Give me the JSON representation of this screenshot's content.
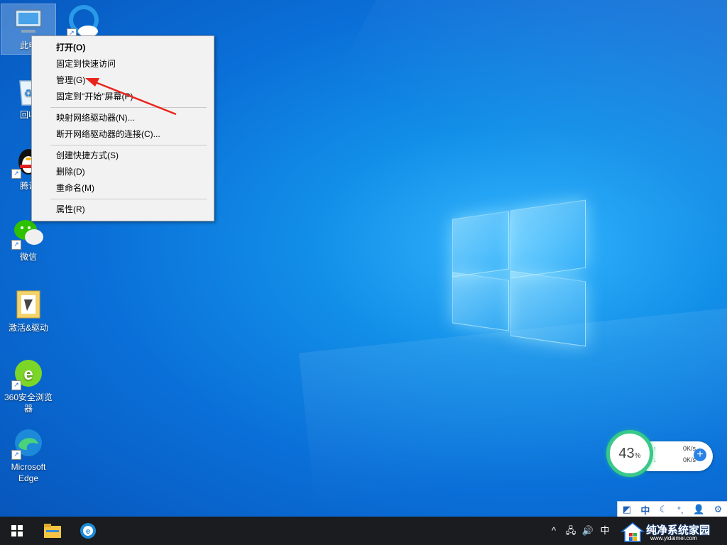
{
  "desktop": {
    "icons": [
      {
        "label": "此电",
        "icon": "computer-icon"
      },
      {
        "label": "",
        "icon": "cloud-drive-icon"
      },
      {
        "label": "回收",
        "icon": "recycle-bin-icon"
      },
      {
        "label": "腾讯",
        "icon": "qq-penguin-icon"
      },
      {
        "label": "微信",
        "icon": "wechat-icon"
      },
      {
        "label": "激活&驱动",
        "icon": "folder-icon"
      },
      {
        "label": "360安全浏览器",
        "icon": "browser-360-icon"
      },
      {
        "label": "Microsoft Edge",
        "icon": "edge-icon"
      }
    ]
  },
  "context_menu": {
    "items": [
      "打开(O)",
      "固定到快速访问",
      "管理(G)",
      "固定到\"开始\"屏幕(P)",
      "映射网络驱动器(N)...",
      "断开网络驱动器的连接(C)...",
      "创建快捷方式(S)",
      "删除(D)",
      "重命名(M)",
      "属性(R)"
    ]
  },
  "net_widget": {
    "percent": "43",
    "percent_unit": "%",
    "upload": "0K/s",
    "download": "0K/s"
  },
  "ime_toolbar": {
    "mode": "中"
  },
  "taskbar": {
    "ime_indicator": "中"
  },
  "watermark": {
    "title": "纯净系统家园",
    "url": "www.yidaimei.com"
  },
  "colors": {
    "accent": "#1e6ed8",
    "taskbar": "#1b1c1f",
    "widget_ring": "#38c98a",
    "arrow": "#e8251c"
  }
}
